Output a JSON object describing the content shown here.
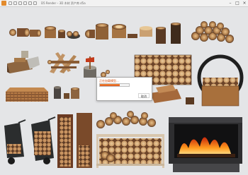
{
  "window": {
    "title": "D5 Render – 3D 木材 资产库.d5a",
    "minimize_glyph": "–",
    "maximize_glyph": "□",
    "close_glyph": "×"
  },
  "loading_dialog": {
    "title": "正在加载模型...",
    "progress_percent": 68,
    "cancel_label": "取消"
  },
  "colors": {
    "accent": "#e0561b",
    "background": "#e4e5e7"
  }
}
